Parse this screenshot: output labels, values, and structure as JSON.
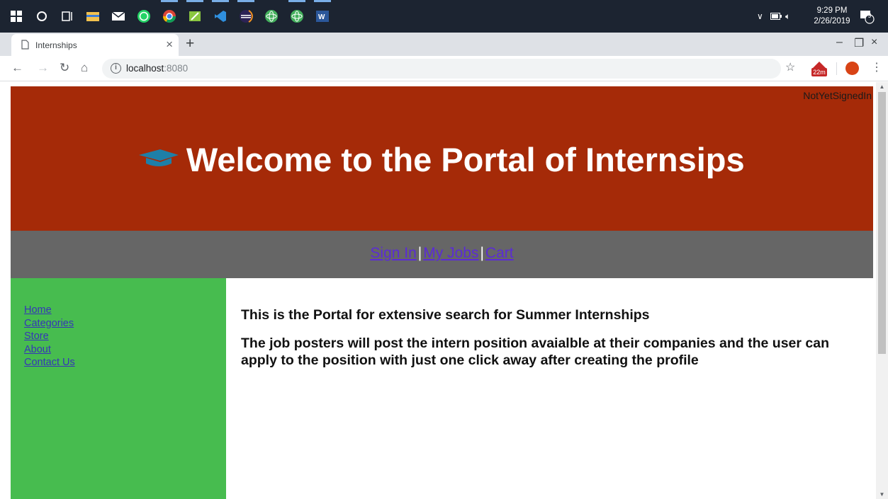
{
  "taskbar": {
    "clock_time": "9:29 PM",
    "clock_date": "2/26/2019",
    "notification_count": "9"
  },
  "browser": {
    "tab_title": "Internships",
    "url_host": "localhost",
    "url_port": ":8080",
    "extension_badge": "22m"
  },
  "page": {
    "signin_status": "NotYetSignedIn",
    "hero_title": "Welcome to the Portal of Internsips",
    "nav": {
      "sign_in": "Sign In",
      "my_jobs": "My Jobs",
      "cart": "Cart",
      "separator": "|"
    },
    "sidebar": {
      "items": [
        "Home",
        "Categories",
        "Store",
        "About",
        "Contact Us"
      ]
    },
    "main": {
      "heading": "This is the Portal for extensive search for Summer Internships",
      "description": "The job posters will post the intern position avaialble at their companies and the user can apply to the position with just one click away after creating the profile"
    }
  },
  "colors": {
    "header_bg": "#a52a08",
    "navbar_bg": "#666666",
    "sidebar_bg": "#47bc4f",
    "link": "#5b2bd6",
    "cap_icon": "#1e7fa8"
  }
}
